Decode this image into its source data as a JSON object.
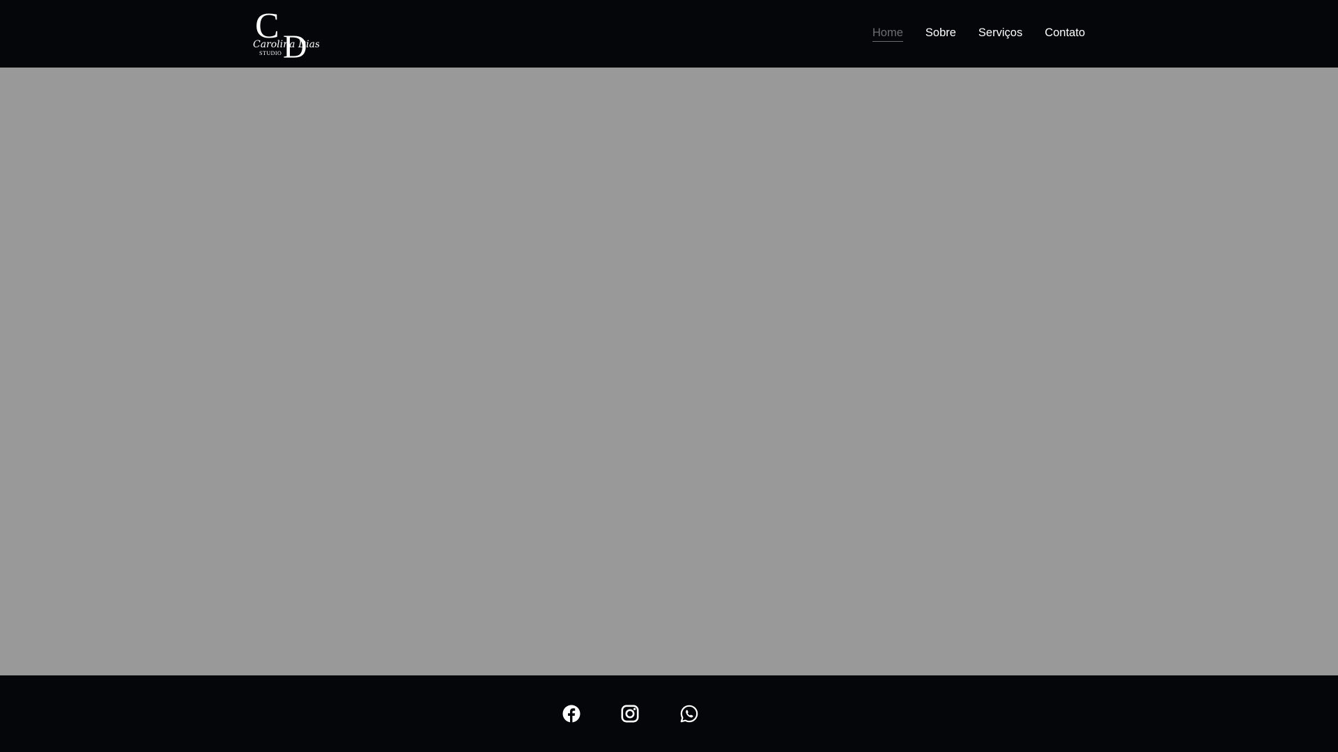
{
  "brand": {
    "monogram_c": "C",
    "monogram_d": "D",
    "script_name": "Carolina Dias",
    "tagline": "STUDIO"
  },
  "nav": {
    "items": [
      {
        "label": "Home",
        "active": true
      },
      {
        "label": "Sobre",
        "active": false
      },
      {
        "label": "Serviços",
        "active": false
      },
      {
        "label": "Contato",
        "active": false
      }
    ]
  },
  "social": [
    {
      "icon": "facebook-icon"
    },
    {
      "icon": "instagram-icon"
    },
    {
      "icon": "whatsapp-icon"
    }
  ],
  "colors": {
    "header_bg": "#050609",
    "hero_bg": "#999999",
    "footer_bg": "#050609",
    "nav_text": "#ffffff",
    "nav_active": "#6e6e72"
  }
}
